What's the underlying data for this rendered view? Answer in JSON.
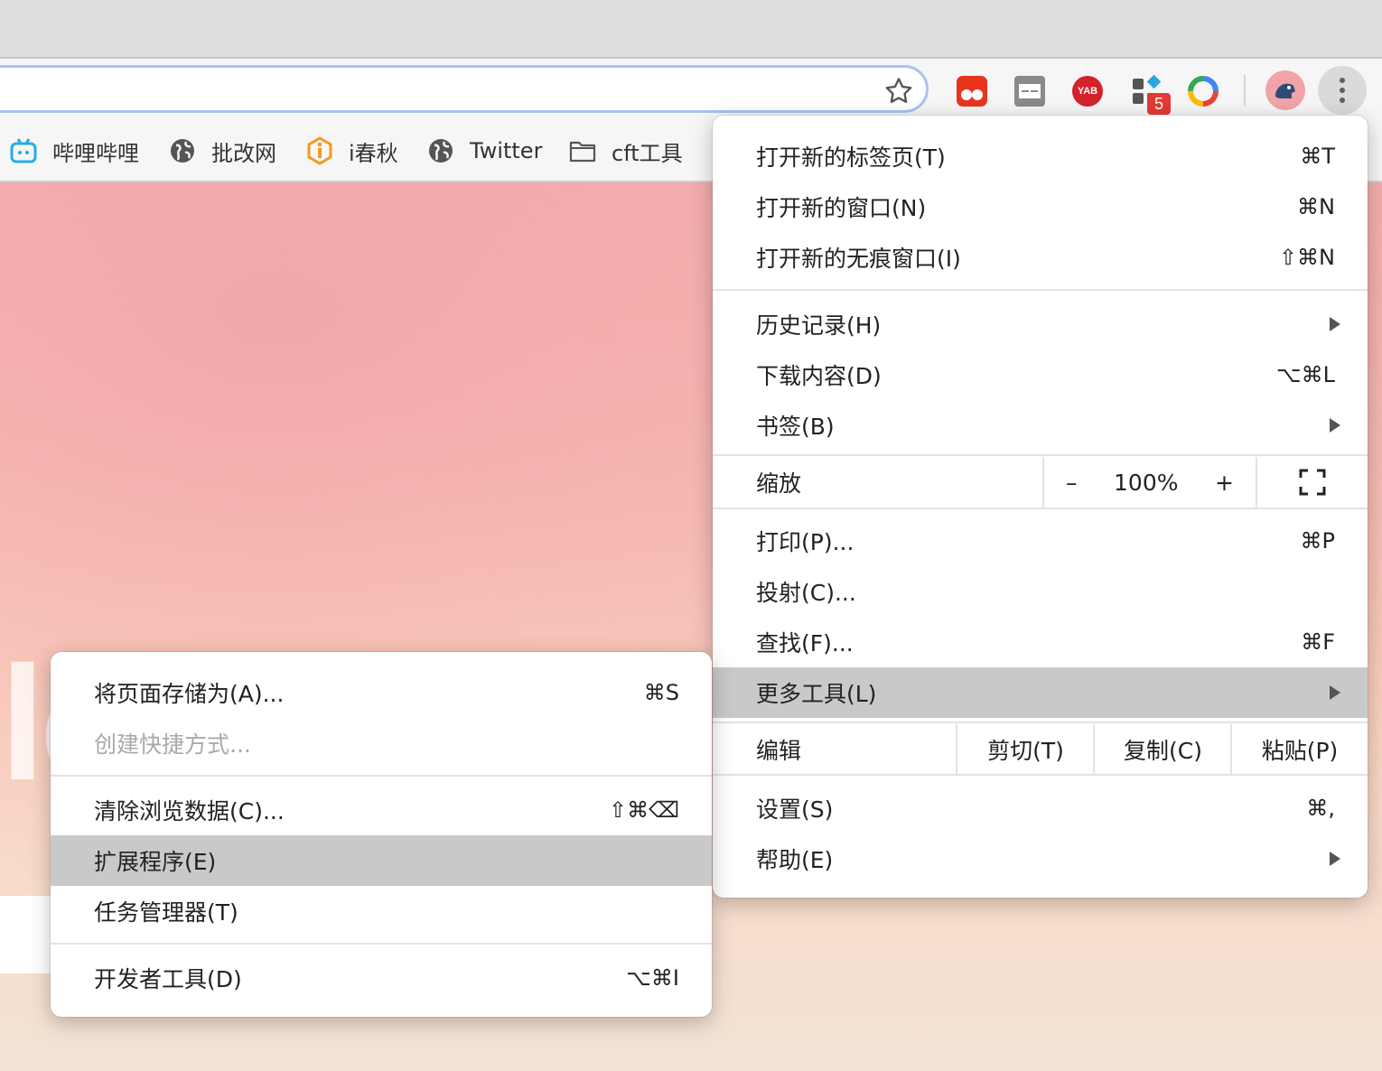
{
  "bookmarks": [
    {
      "label": "哔哩哔哩",
      "icon": "bilibili-icon"
    },
    {
      "label": "批改网",
      "icon": "globe-icon"
    },
    {
      "label": "i春秋",
      "icon": "ichunqiu-icon"
    },
    {
      "label": "Twitter",
      "icon": "globe-icon"
    },
    {
      "label": "cft工具",
      "icon": "folder-icon"
    }
  ],
  "extensions": {
    "badge_count": "5",
    "yab_label": "YAB"
  },
  "page": {
    "logo_fragment": "le"
  },
  "main_menu": {
    "items": [
      {
        "label": "打开新的标签页(T)",
        "shortcut": "⌘T"
      },
      {
        "label": "打开新的窗口(N)",
        "shortcut": "⌘N"
      },
      {
        "label": "打开新的无痕窗口(I)",
        "shortcut": "⇧⌘N"
      },
      {
        "label": "历史记录(H)",
        "shortcut": ""
      },
      {
        "label": "下载内容(D)",
        "shortcut": "⌥⌘L"
      },
      {
        "label": "书签(B)",
        "shortcut": ""
      },
      {
        "label": "打印(P)...",
        "shortcut": "⌘P"
      },
      {
        "label": "投射(C)...",
        "shortcut": ""
      },
      {
        "label": "查找(F)...",
        "shortcut": "⌘F"
      },
      {
        "label": "更多工具(L)",
        "shortcut": ""
      },
      {
        "label": "设置(S)",
        "shortcut": "⌘,"
      },
      {
        "label": "帮助(E)",
        "shortcut": ""
      }
    ],
    "zoom": {
      "label": "缩放",
      "minus": "–",
      "value": "100%",
      "plus": "+"
    },
    "edit": {
      "label": "编辑",
      "cut": "剪切(T)",
      "copy": "复制(C)",
      "paste": "粘贴(P)"
    }
  },
  "sub_menu": {
    "items": [
      {
        "label": "将页面存储为(A)...",
        "shortcut": "⌘S"
      },
      {
        "label": "创建快捷方式...",
        "shortcut": ""
      },
      {
        "label": "清除浏览数据(C)...",
        "shortcut": "⇧⌘⌫"
      },
      {
        "label": "扩展程序(E)",
        "shortcut": ""
      },
      {
        "label": "任务管理器(T)",
        "shortcut": ""
      },
      {
        "label": "开发者工具(D)",
        "shortcut": "⌥⌘I"
      }
    ]
  },
  "colors": {
    "highlight": "#c9c9c9",
    "omnibox_border": "#a8c4ef",
    "badge": "#e53935"
  }
}
